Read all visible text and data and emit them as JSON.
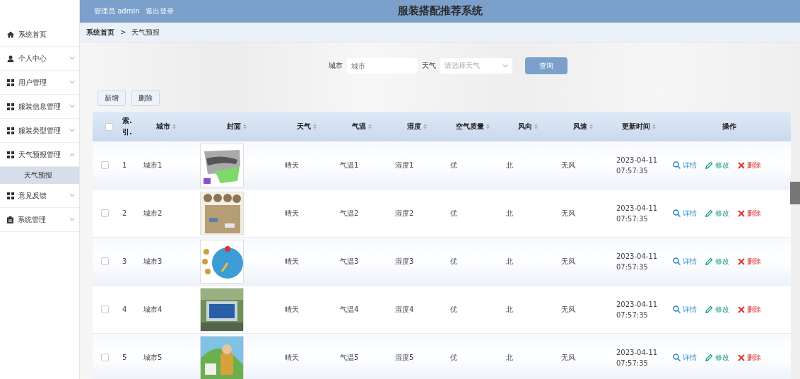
{
  "header": {
    "user_label": "管理员 admin",
    "logout": "退出登录",
    "title": "服装搭配推荐系统"
  },
  "sidebar": {
    "items": [
      {
        "label": "系统首页",
        "kind": "home",
        "expandable": false
      },
      {
        "label": "个人中心",
        "kind": "user",
        "expandable": true,
        "expanded": false
      },
      {
        "label": "用户管理",
        "kind": "grid",
        "expandable": true,
        "expanded": false
      },
      {
        "label": "服装信息管理",
        "kind": "grid",
        "expandable": true,
        "expanded": false
      },
      {
        "label": "服装类型管理",
        "kind": "grid",
        "expandable": true,
        "expanded": false
      },
      {
        "label": "天气预报管理",
        "kind": "grid",
        "expandable": true,
        "expanded": true,
        "children": [
          {
            "label": "天气预报",
            "selected": true
          }
        ]
      },
      {
        "label": "意见反馈",
        "kind": "grid",
        "expandable": true,
        "expanded": false
      },
      {
        "label": "系统管理",
        "kind": "clipboard",
        "expandable": true,
        "expanded": false
      }
    ]
  },
  "breadcrumb": [
    "系统首页",
    "天气预报"
  ],
  "breadcrumb_separator": ">",
  "search": {
    "fields": [
      {
        "label": "城市",
        "kind": "input",
        "placeholder": "城市"
      },
      {
        "label": "天气",
        "kind": "select",
        "placeholder": "请选择天气"
      }
    ],
    "button": "查询"
  },
  "actions": [
    "新增",
    "删除"
  ],
  "table": {
    "all_selected": false,
    "columns": [
      {
        "label": "索.引.",
        "sortable": false
      },
      {
        "label": "城市",
        "sortable": true
      },
      {
        "label": "封面",
        "sortable": true
      },
      {
        "label": "天气",
        "sortable": true
      },
      {
        "label": "气温",
        "sortable": true
      },
      {
        "label": "湿度",
        "sortable": true
      },
      {
        "label": "空气质量",
        "sortable": true
      },
      {
        "label": "风向",
        "sortable": true
      },
      {
        "label": "风速",
        "sortable": true
      },
      {
        "label": "更新时间",
        "sortable": true
      },
      {
        "label": "操作",
        "sortable": false
      }
    ],
    "rows": [
      {
        "selected": false,
        "cells": [
          "1",
          "城市1",
          "晴天",
          "气温1",
          "湿度1",
          "优",
          "北",
          "无风"
        ],
        "time": [
          "2023-04-11",
          "07:57:35"
        ],
        "actions": [
          {
            "label": "详情",
            "kind": "view"
          },
          {
            "label": "修改",
            "kind": "edit"
          },
          {
            "label": "删除",
            "kind": "delete"
          }
        ]
      },
      {
        "selected": false,
        "cells": [
          "2",
          "城市2",
          "晴天",
          "气温2",
          "湿度2",
          "优",
          "北",
          "无风"
        ],
        "time": [
          "2023-04-11",
          "07:57:35"
        ],
        "actions": [
          {
            "label": "详情",
            "kind": "view"
          },
          {
            "label": "修改",
            "kind": "edit"
          },
          {
            "label": "删除",
            "kind": "delete"
          }
        ]
      },
      {
        "selected": false,
        "cells": [
          "3",
          "城市3",
          "晴天",
          "气温3",
          "湿度3",
          "优",
          "北",
          "无风"
        ],
        "time": [
          "2023-04-11",
          "07:57:35"
        ],
        "actions": [
          {
            "label": "详情",
            "kind": "view"
          },
          {
            "label": "修改",
            "kind": "edit"
          },
          {
            "label": "删除",
            "kind": "delete"
          }
        ]
      },
      {
        "selected": false,
        "cells": [
          "4",
          "城市4",
          "晴天",
          "气温4",
          "湿度4",
          "优",
          "北",
          "无风"
        ],
        "time": [
          "2023-04-11",
          "07:57:35"
        ],
        "actions": [
          {
            "label": "详情",
            "kind": "view"
          },
          {
            "label": "修改",
            "kind": "edit"
          },
          {
            "label": "删除",
            "kind": "delete"
          }
        ]
      },
      {
        "selected": false,
        "cells": [
          "5",
          "城市5",
          "晴天",
          "气温5",
          "湿度5",
          "优",
          "北",
          "无风"
        ],
        "time": [
          "2023-04-11",
          "07:57:35"
        ],
        "actions": [
          {
            "label": "详情",
            "kind": "view"
          },
          {
            "label": "修改",
            "kind": "edit"
          },
          {
            "label": "删除",
            "kind": "delete"
          }
        ]
      }
    ]
  }
}
